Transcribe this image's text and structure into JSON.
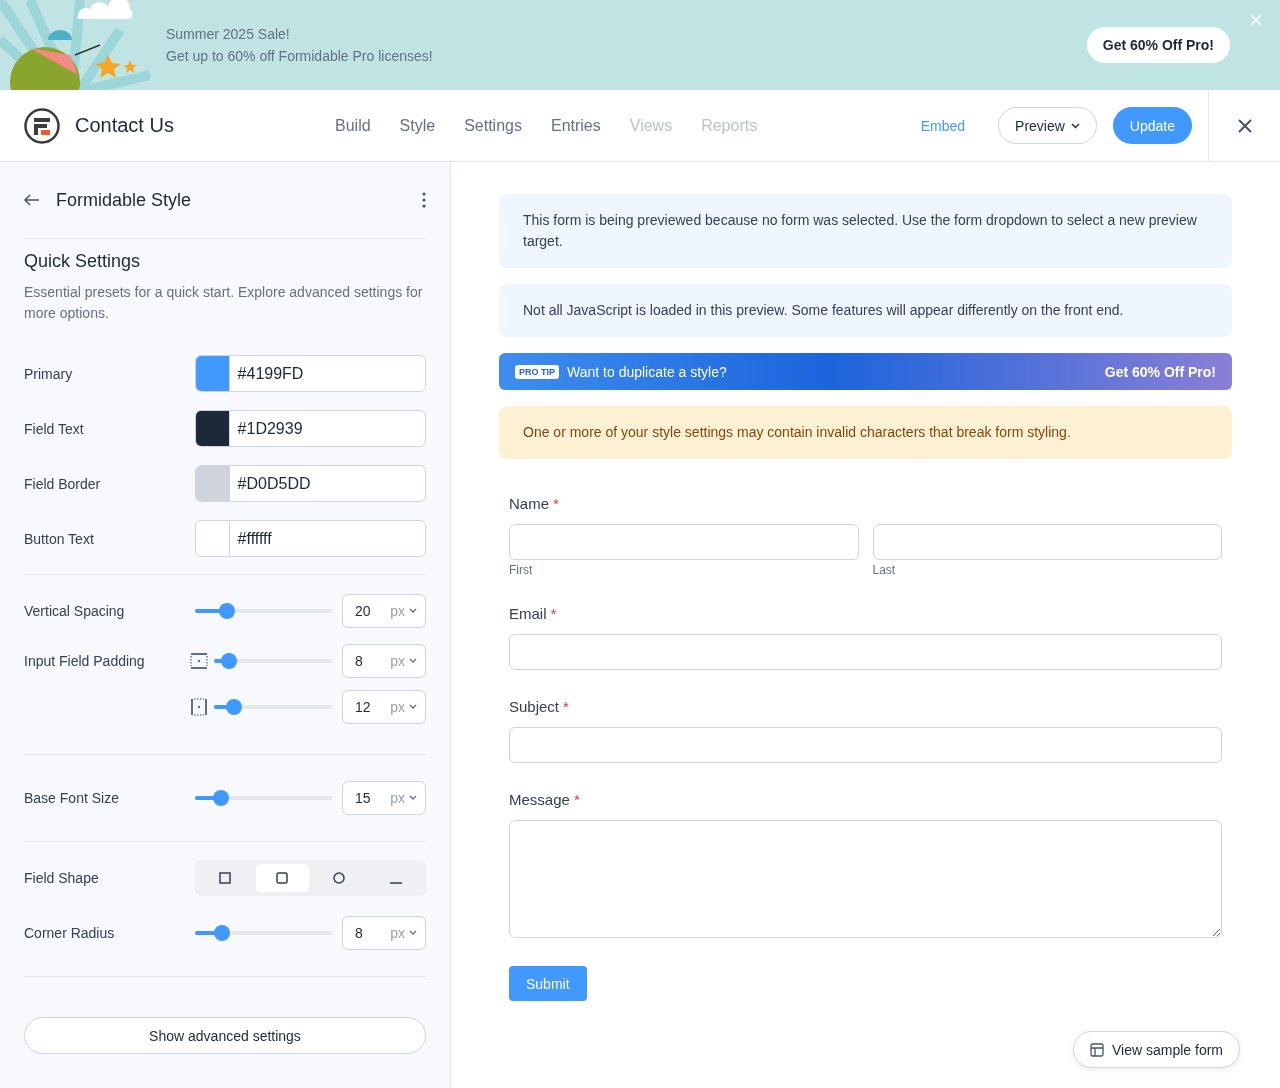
{
  "banner": {
    "title": "Summer 2025 Sale!",
    "text": "Get up to 60% off Formidable Pro licenses!",
    "cta": "Get 60% Off Pro!"
  },
  "header": {
    "title": "Contact Us",
    "nav": [
      {
        "label": "Build",
        "disabled": false
      },
      {
        "label": "Style",
        "disabled": false
      },
      {
        "label": "Settings",
        "disabled": false
      },
      {
        "label": "Entries",
        "disabled": false
      },
      {
        "label": "Views",
        "disabled": true
      },
      {
        "label": "Reports",
        "disabled": true
      }
    ],
    "embed": "Embed",
    "preview": "Preview",
    "update": "Update"
  },
  "sidebar": {
    "title": "Formidable Style",
    "section": "Quick Settings",
    "description": "Essential presets for a quick start. Explore advanced settings for more options.",
    "colors": [
      {
        "label": "Primary",
        "color": "#4199fd",
        "value": "#4199FD"
      },
      {
        "label": "Field Text",
        "color": "#1d2939",
        "value": "#1D2939"
      },
      {
        "label": "Field Border",
        "color": "#d0d5dd",
        "value": "#D0D5DD"
      },
      {
        "label": "Button Text",
        "color": "#ffffff",
        "value": "#ffffff"
      }
    ],
    "vertical_spacing": {
      "label": "Vertical Spacing",
      "level": 0.23,
      "value": "20",
      "unit": "px"
    },
    "padding": {
      "label": "Input Field Padding",
      "rows": [
        {
          "kind": "vertical",
          "level": 0.13,
          "value": "8",
          "unit": "px"
        },
        {
          "kind": "horizontal",
          "level": 0.17,
          "value": "12",
          "unit": "px"
        }
      ]
    },
    "font_size": {
      "label": "Base Font Size",
      "level": 0.19,
      "value": "15",
      "unit": "px"
    },
    "field_shape": {
      "label": "Field Shape",
      "options": [
        {
          "kind": "square",
          "selected": false
        },
        {
          "kind": "rounded",
          "selected": true
        },
        {
          "kind": "circle",
          "selected": false
        },
        {
          "kind": "underline",
          "selected": false
        }
      ]
    },
    "corner_radius": {
      "label": "Corner Radius",
      "level": 0.2,
      "value": "8",
      "unit": "px"
    },
    "advanced": "Show advanced settings"
  },
  "preview": {
    "notices": [
      {
        "kind": "info",
        "text": "This form is being previewed because no form was selected. Use the form dropdown to select a new preview target."
      },
      {
        "kind": "info",
        "text": "Not all JavaScript is loaded in this preview. Some features will appear differently on the front end."
      }
    ],
    "pro_tip": {
      "badge": "PRO TIP",
      "text": "Want to duplicate a style?",
      "cta": "Get 60% Off Pro!"
    },
    "warning": "One or more of your style settings may contain invalid characters that break form styling.",
    "fields": [
      {
        "kind": "name",
        "label": "Name",
        "marker": "*",
        "parts": [
          "First",
          "Last"
        ]
      },
      {
        "kind": "text",
        "label": "Email",
        "marker": "*"
      },
      {
        "kind": "text",
        "label": "Subject",
        "marker": "*"
      },
      {
        "kind": "textarea",
        "label": "Message",
        "marker": "*"
      }
    ],
    "submit": "Submit",
    "sample": "View sample form"
  }
}
